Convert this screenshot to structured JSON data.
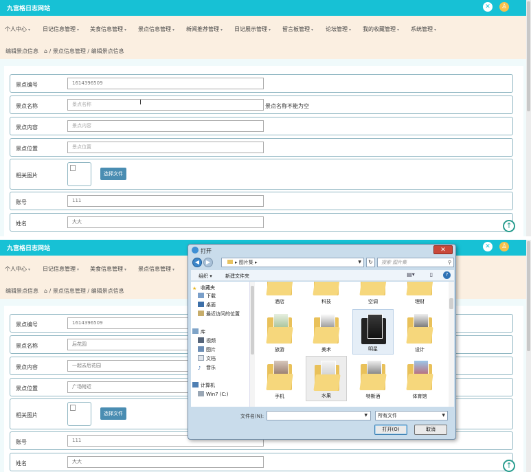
{
  "site_title": "九宫格日志网站",
  "menu": [
    "个人中心",
    "日记信息管理",
    "美食信息管理",
    "景点信息管理",
    "新闻推荐管理",
    "日记展示管理",
    "留言板管理",
    "论坛管理",
    "我的收藏管理",
    "系统管理"
  ],
  "breadcrumb": {
    "home": "编辑景点信息",
    "path": "⌂ / 景点信息管理 / 编辑景点信息"
  },
  "form_labels": [
    "景点编号",
    "景点名称",
    "景点内容",
    "景点位置",
    "相关图片",
    "账号",
    "姓名"
  ],
  "select_file_label": "选择文件",
  "before": {
    "number": "1614396509",
    "name_placeholder": "景点名称",
    "name_error": "景点名称不能为空",
    "content_placeholder": "景点内容",
    "location_placeholder": "景点位置",
    "account": "111",
    "realname": "大大"
  },
  "after": {
    "number": "1614396509",
    "name": "后花园",
    "content": "一起去后花园",
    "location": "广场附近",
    "account": "111",
    "realname": "大大"
  },
  "dialog": {
    "title": "打开",
    "path": "图片集",
    "search_placeholder": "搜索 图片集",
    "organize": "组织 ▾",
    "new_folder": "新建文件夹",
    "nav": {
      "favorites": "收藏夹",
      "downloads": "下载",
      "desktop": "桌面",
      "recent": "最近访问的位置",
      "libraries": "库",
      "videos": "视频",
      "pictures": "图片",
      "documents": "文档",
      "music": "音乐",
      "computer": "计算机",
      "win7": "Win7 (C:)"
    },
    "folders": [
      "酒店",
      "科技",
      "空调",
      "理财",
      "旅游",
      "美术",
      "明星",
      "设计",
      "手机",
      "水果",
      "特斯酒",
      "体育馆"
    ],
    "filename_label": "文件名(N):",
    "filetype": "所有文件",
    "open_button": "打开(O)",
    "cancel_button": "取消"
  }
}
